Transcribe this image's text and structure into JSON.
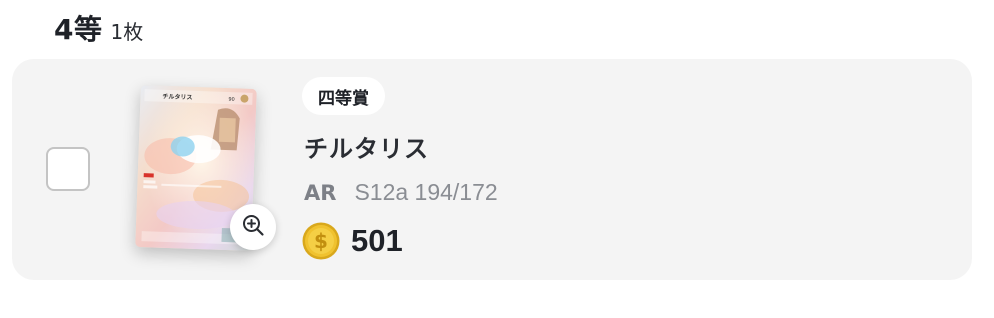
{
  "tier": {
    "name": "4等",
    "count": "1枚"
  },
  "prize": {
    "rank_badge": "四等賞",
    "card_name": "チルタリス",
    "rarity": "AR",
    "set_number": "S12a 194/172",
    "points": "501",
    "card_image_text": {
      "name": "チルタリス",
      "hp": "90"
    }
  },
  "icons": {
    "zoom": "zoom-in-icon",
    "coin": "coin-icon"
  },
  "colors": {
    "row_background": "#f4f4f4",
    "coin_gold": "#f0c22f",
    "text_primary": "#1f2228",
    "text_muted": "#8a8d93"
  }
}
